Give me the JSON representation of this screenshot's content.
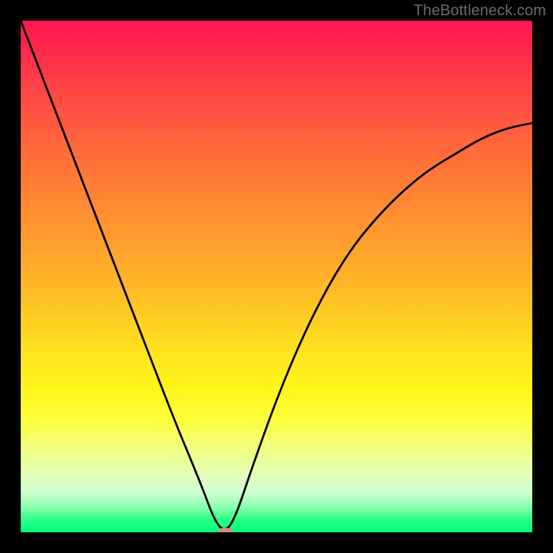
{
  "watermark": "TheBottleneck.com",
  "chart_data": {
    "type": "line",
    "title": "",
    "xlabel": "",
    "ylabel": "",
    "xlim": [
      0,
      100
    ],
    "ylim": [
      0,
      100
    ],
    "grid": false,
    "legend": false,
    "background": "rainbow-gradient (red top to green bottom)",
    "series": [
      {
        "name": "bottleneck-curve",
        "color": "#000000",
        "x": [
          0,
          5,
          10,
          15,
          20,
          25,
          30,
          35,
          38,
          40,
          42,
          45,
          50,
          55,
          60,
          65,
          70,
          75,
          80,
          85,
          90,
          95,
          100
        ],
        "y": [
          100,
          87,
          74,
          61,
          48,
          35,
          22,
          10,
          2,
          0,
          3,
          12,
          26,
          38,
          48,
          56,
          62,
          67,
          71,
          74,
          77,
          79,
          80
        ]
      }
    ],
    "marker": {
      "x": 40,
      "y": 0,
      "color": "#d98b8b"
    },
    "gradient_stops": [
      {
        "pos": 0,
        "color": "#ff1552"
      },
      {
        "pos": 50,
        "color": "#ffc225"
      },
      {
        "pos": 75,
        "color": "#fff61a"
      },
      {
        "pos": 100,
        "color": "#00ff77"
      }
    ]
  }
}
